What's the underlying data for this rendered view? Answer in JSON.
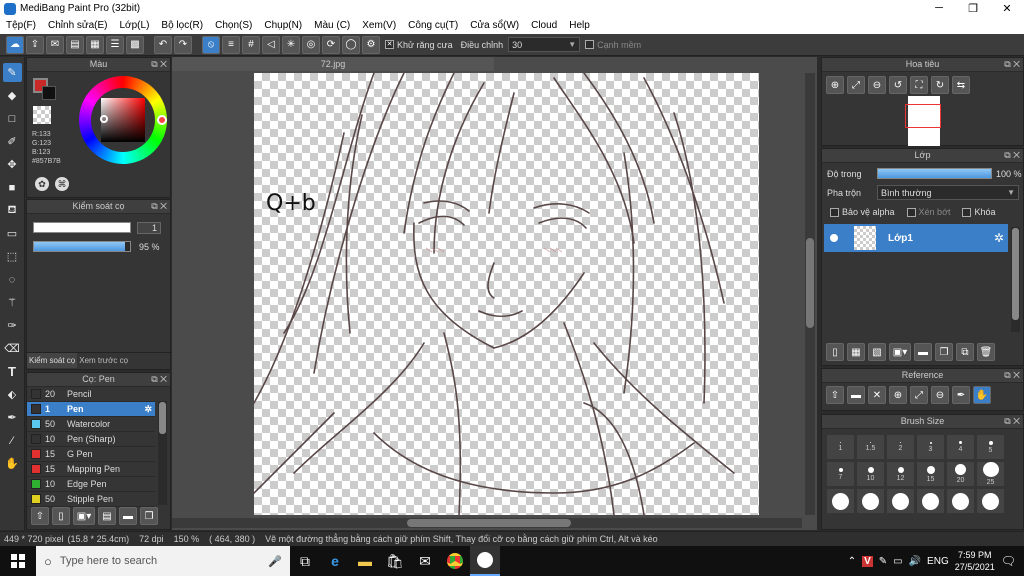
{
  "window": {
    "title": "MediBang Paint Pro (32bit)"
  },
  "menu": [
    "Tệp(F)",
    "Chỉnh sửa(E)",
    "Lớp(L)",
    "Bộ lọc(R)",
    "Chọn(S)",
    "Chụp(N)",
    "Màu (C)",
    "Xem(V)",
    "Công cụ(T)",
    "Cửa sổ(W)",
    "Cloud",
    "Help"
  ],
  "toolbar": {
    "antialias_label": "Khử răng cưa",
    "adjust_label": "Điều chỉnh",
    "adjust_value": "30",
    "snap_label": "Cạnh mềm"
  },
  "color_panel": {
    "title": "Màu",
    "r": "R:133",
    "g": "G:123",
    "b": "B:123",
    "hex": "#857B7B",
    "fg_color": "#c82828"
  },
  "brush_control": {
    "title": "Kiểm soát cọ",
    "size": "1",
    "opacity": "95 %",
    "tab1": "Kiểm soát cọ",
    "tab2": "Xem trước cọ"
  },
  "brushes": {
    "title": "Cọ: Pen",
    "items": [
      {
        "size": "20",
        "name": "Pencil",
        "color": "#333333"
      },
      {
        "size": "1",
        "name": "Pen",
        "color": "#333333",
        "selected": true
      },
      {
        "size": "50",
        "name": "Watercolor",
        "color": "#5bc8f0"
      },
      {
        "size": "10",
        "name": "Pen (Sharp)",
        "color": "#333333"
      },
      {
        "size": "15",
        "name": "G Pen",
        "color": "#e03030"
      },
      {
        "size": "15",
        "name": "Mapping Pen",
        "color": "#e03030"
      },
      {
        "size": "10",
        "name": "Edge Pen",
        "color": "#30b030"
      },
      {
        "size": "50",
        "name": "Stipple Pen",
        "color": "#e0d020"
      }
    ]
  },
  "canvas": {
    "tab": "72.jpg",
    "signature": "Q+b"
  },
  "navigator": {
    "title": "Hoa tiêu"
  },
  "layers": {
    "title": "Lớp",
    "opacity_label": "Độ trong",
    "opacity_value": "100 %",
    "blend_label": "Pha trộn",
    "blend_value": "Bình thường",
    "protect_alpha": "Bảo vệ alpha",
    "clipping": "Xén bớt",
    "lock": "Khóa",
    "layer_name": "Lớp1"
  },
  "reference": {
    "title": "Reference"
  },
  "brush_size": {
    "title": "Brush Size",
    "cells": [
      {
        "label": "1",
        "d": 1
      },
      {
        "label": "1.5",
        "d": 1
      },
      {
        "label": "2",
        "d": 1
      },
      {
        "label": "3",
        "d": 2
      },
      {
        "label": "4",
        "d": 3
      },
      {
        "label": "5",
        "d": 4
      },
      {
        "label": "7",
        "d": 4
      },
      {
        "label": "10",
        "d": 6
      },
      {
        "label": "12",
        "d": 6
      },
      {
        "label": "15",
        "d": 8
      },
      {
        "label": "20",
        "d": 11
      },
      {
        "label": "25",
        "d": 16
      },
      {
        "label": "",
        "d": 17
      },
      {
        "label": "",
        "d": 17
      },
      {
        "label": "",
        "d": 17
      },
      {
        "label": "",
        "d": 17
      },
      {
        "label": "",
        "d": 17
      },
      {
        "label": "",
        "d": 17
      }
    ]
  },
  "status": {
    "dims": "449 * 720 pixel",
    "size_cm": "(15.8 * 25.4cm)",
    "dpi": "72 dpi",
    "zoom": "150 %",
    "coords": "( 464, 380 )",
    "hint": "Vẽ một đường thẳng bằng cách giữ phím Shift, Thay đổi cỡ cọ bằng cách giữ phím Ctrl, Alt và kéo"
  },
  "taskbar": {
    "search_placeholder": "Type here to search",
    "lang": "ENG",
    "time": "7:59 PM",
    "date": "27/5/2021"
  }
}
